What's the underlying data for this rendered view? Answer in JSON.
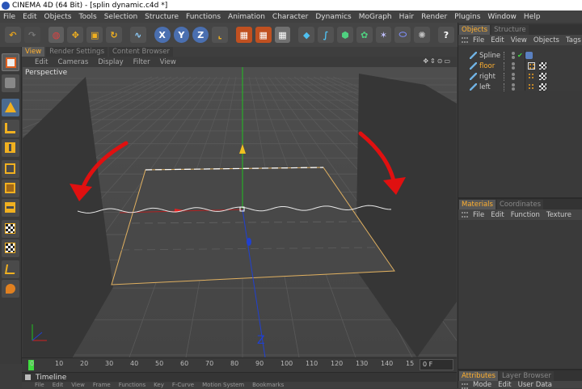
{
  "title": "CINEMA 4D (64 Bit) - [splin dynamic.c4d *]",
  "menu": [
    "File",
    "Edit",
    "Objects",
    "Tools",
    "Selection",
    "Structure",
    "Functions",
    "Animation",
    "Character",
    "Dynamics",
    "MoGraph",
    "Hair",
    "Render",
    "Plugins",
    "Window",
    "Help"
  ],
  "toolbar_icons": [
    {
      "name": "undo-icon",
      "glyph": "↶",
      "color": "#e0a020",
      "bg": "#525252"
    },
    {
      "name": "redo-icon",
      "glyph": "↷",
      "color": "#777777",
      "bg": "#4a4a4a"
    },
    {
      "name": "live-selection-icon",
      "glyph": "◍",
      "color": "#e04040",
      "bg": "#5e5e5e"
    },
    {
      "name": "move-icon",
      "glyph": "✥",
      "color": "#f0b020",
      "bg": "#525252"
    },
    {
      "name": "scale-icon",
      "glyph": "▣",
      "color": "#f0b020",
      "bg": "#525252"
    },
    {
      "name": "rotate-icon",
      "glyph": "↻",
      "color": "#f0b020",
      "bg": "#525252"
    },
    {
      "name": "spline-icon",
      "glyph": "∿",
      "color": "#8fd0ff",
      "bg": "#525252"
    },
    {
      "name": "x-axis-icon",
      "glyph": "X",
      "color": "#ffffff",
      "bg": "#4a6fb0"
    },
    {
      "name": "y-axis-icon",
      "glyph": "Y",
      "color": "#ffffff",
      "bg": "#4a6fb0"
    },
    {
      "name": "z-axis-icon",
      "glyph": "Z",
      "color": "#ffffff",
      "bg": "#4a6fb0"
    },
    {
      "name": "coordinate-system-icon",
      "glyph": "⌞",
      "color": "#f0b020",
      "bg": "#525252"
    },
    {
      "name": "render-view-icon",
      "glyph": "▦",
      "color": "#ffffff",
      "bg": "#c05020"
    },
    {
      "name": "render-picture-viewer-icon",
      "glyph": "▦",
      "color": "#ffffff",
      "bg": "#c05020"
    },
    {
      "name": "render-settings-icon",
      "glyph": "▦",
      "color": "#ffffff",
      "bg": "#707070"
    },
    {
      "name": "cube-icon",
      "glyph": "◆",
      "color": "#4fc0f0",
      "bg": "#525252"
    },
    {
      "name": "spline-pen-icon",
      "glyph": "∫",
      "color": "#4fc0f0",
      "bg": "#525252"
    },
    {
      "name": "nurbs-icon",
      "glyph": "⬢",
      "color": "#4fd080",
      "bg": "#525252"
    },
    {
      "name": "array-icon",
      "glyph": "✿",
      "color": "#4fd080",
      "bg": "#525252"
    },
    {
      "name": "deformer-icon",
      "glyph": "✶",
      "color": "#c0c0ff",
      "bg": "#525252"
    },
    {
      "name": "scene-icon",
      "glyph": "⬭",
      "color": "#8090ff",
      "bg": "#525252"
    },
    {
      "name": "light-icon",
      "glyph": "✺",
      "color": "#c0c0c0",
      "bg": "#525252"
    },
    {
      "name": "help-icon",
      "glyph": "?",
      "color": "#ffffff",
      "bg": "#525252"
    }
  ],
  "view_tabs": [
    {
      "label": "View",
      "active": true
    },
    {
      "label": "Render Settings",
      "active": false
    },
    {
      "label": "Content Browser",
      "active": false
    }
  ],
  "view_menu": [
    "Edit",
    "Cameras",
    "Display",
    "Filter",
    "View"
  ],
  "viewport_label": "Perspective",
  "timeline": {
    "ticks": [
      "0",
      "10",
      "20",
      "30",
      "40",
      "50",
      "60",
      "70",
      "80",
      "90",
      "100",
      "110",
      "120",
      "130",
      "140",
      "15"
    ],
    "frame": "0 F",
    "label": "Timeline",
    "bottom_menu": [
      "File",
      "Edit",
      "View",
      "Frame",
      "Functions",
      "Key",
      "F-Curve",
      "Motion System",
      "Bookmarks"
    ]
  },
  "objects_panel": {
    "tabs": [
      {
        "label": "Objects",
        "active": true
      },
      {
        "label": "Structure",
        "active": false
      }
    ],
    "menu": [
      "File",
      "Edit",
      "View",
      "Objects",
      "Tags"
    ],
    "objects": [
      {
        "name": "Spline",
        "selected": false
      },
      {
        "name": "floor",
        "selected": true
      },
      {
        "name": "right",
        "selected": false
      },
      {
        "name": "left",
        "selected": false
      }
    ]
  },
  "materials_panel": {
    "tabs": [
      {
        "label": "Materials",
        "active": true
      },
      {
        "label": "Coordinates",
        "active": false
      }
    ],
    "menu": [
      "File",
      "Edit",
      "Function",
      "Texture"
    ]
  },
  "attributes_panel": {
    "tabs": [
      {
        "label": "Attributes",
        "active": true
      },
      {
        "label": "Layer Browser",
        "active": false
      }
    ],
    "menu": [
      "Mode",
      "Edit",
      "User Data"
    ]
  },
  "colors": {
    "accent": "#ffb030",
    "x_axis": "#d02020",
    "y_axis": "#20c020",
    "z_axis": "#2040d0",
    "annotation": "#e01010"
  }
}
